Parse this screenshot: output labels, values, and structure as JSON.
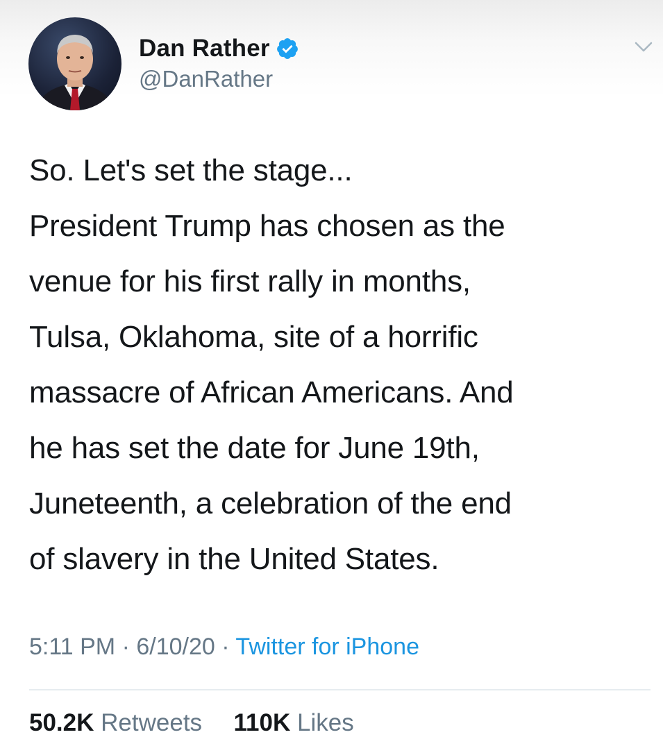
{
  "author": {
    "display_name": "Dan Rather",
    "handle": "@DanRather",
    "verified": true,
    "avatar_icon": "profile-photo"
  },
  "tweet": {
    "text": "So. Let's set the stage...\nPresident Trump has chosen as the\nvenue for his first rally in months,\nTulsa, Oklahoma, site of a horrific\nmassacre of African Americans. And\nhe has set the date for June 19th,\nJuneteenth, a celebration of the end\nof slavery in the United States.",
    "time": "5:11 PM",
    "separator": "·",
    "date": "6/10/20",
    "source": "Twitter for iPhone"
  },
  "stats": {
    "retweets_count": "50.2K",
    "retweets_label": "Retweets",
    "likes_count": "110K",
    "likes_label": "Likes"
  },
  "colors": {
    "text_primary": "#14171a",
    "text_secondary": "#657786",
    "link": "#1b95e0",
    "verified_badge": "#1da1f2",
    "divider": "#e6ecf0"
  },
  "icons": {
    "verified": "verified-badge-icon",
    "menu": "chevron-down-icon"
  }
}
